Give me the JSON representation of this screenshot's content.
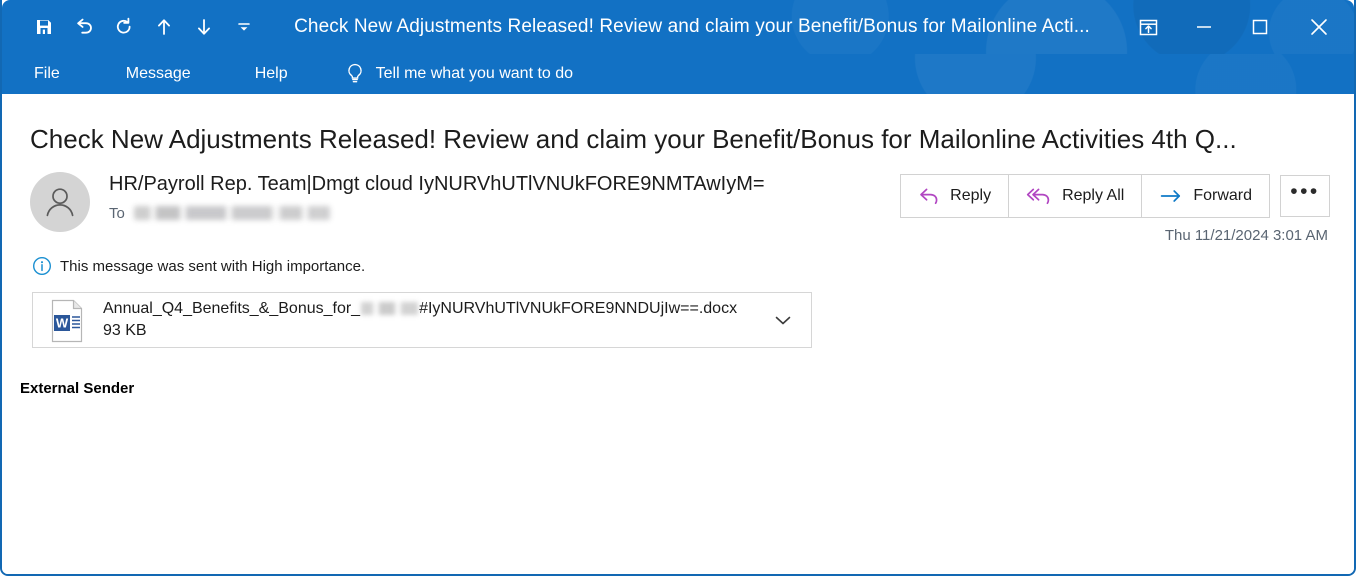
{
  "window": {
    "title": "Check New Adjustments Released! Review and claim your Benefit/Bonus for Mailonline Acti...",
    "accent_color": "#1271c4",
    "quick_access": [
      {
        "name": "save-icon",
        "label": "Save"
      },
      {
        "name": "undo-icon",
        "label": "Undo"
      },
      {
        "name": "redo-icon",
        "label": "Redo"
      },
      {
        "name": "previous-item-icon",
        "label": "Previous Item"
      },
      {
        "name": "next-item-icon",
        "label": "Next Item"
      },
      {
        "name": "customize-quick-access-toolbar-icon",
        "label": "Customize Quick Access Toolbar"
      }
    ],
    "controls": [
      {
        "name": "restore-down-ribbon-icon",
        "label": "Ribbon Display Options"
      },
      {
        "name": "minimize-icon",
        "label": "Minimize"
      },
      {
        "name": "maximize-icon",
        "label": "Maximize"
      },
      {
        "name": "close-icon",
        "label": "Close"
      }
    ]
  },
  "ribbon": {
    "tabs": [
      {
        "label": "File"
      },
      {
        "label": "Message"
      },
      {
        "label": "Help"
      }
    ],
    "tell_me": {
      "icon": "lightbulb-icon",
      "label": "Tell me what you want to do"
    }
  },
  "message": {
    "subject": "Check New Adjustments Released! Review and claim your Benefit/Bonus for Mailonline Activities 4th Q...",
    "sender_name": "HR/Payroll Rep. Team|Dmgt cloud IyNURVhUTlVNUkFORE9NMTAwIyM=",
    "to_label": "To",
    "to_value": "",
    "timestamp": "Thu 11/21/2024 3:01 AM",
    "importance_notice": "This message was sent with High importance.",
    "importance_icon": "info-icon",
    "actions": [
      {
        "label": "Reply",
        "icon": "reply-arrow-icon",
        "color": "#b146c2"
      },
      {
        "label": "Reply All",
        "icon": "reply-all-arrow-icon",
        "color": "#b146c2"
      },
      {
        "label": "Forward",
        "icon": "forward-arrow-icon",
        "color": "#0f7ac7"
      }
    ],
    "more_actions_label": "•••",
    "attachment": {
      "icon": "word-document-icon",
      "name_prefix": "Annual_Q4_Benefits_&_Bonus_for_",
      "name_suffix": "#IyNURVhUTlVNUkFORE9NNDUjIw==.docx",
      "size": "93 KB",
      "chevron_icon": "chevron-down-icon"
    },
    "body": "External Sender"
  }
}
